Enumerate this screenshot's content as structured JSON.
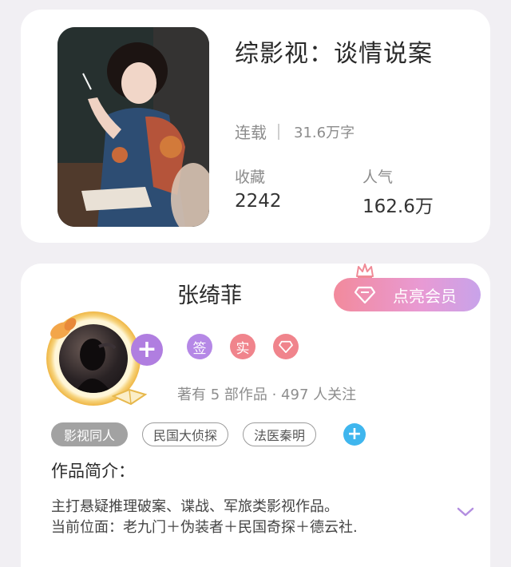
{
  "book": {
    "title": "综影视：谈情说案",
    "status": "连载",
    "word_count": "31.6万字",
    "favorites_label": "收藏",
    "favorites_value": "2242",
    "popularity_label": "人气",
    "popularity_value": "162.6万"
  },
  "author": {
    "name": "张绮菲",
    "vip_button": "点亮会员",
    "badges": [
      {
        "label": "签",
        "color": "#b588e6"
      },
      {
        "label": "实",
        "color": "#f0848c"
      },
      {
        "label": "diamond-icon",
        "color": "#f0848c"
      }
    ],
    "follow_text": "著有 5 部作品 · 497 人关注",
    "tags": [
      "影视同人",
      "民国大侦探",
      "法医秦明"
    ],
    "intro_title": "作品简介：",
    "intro_lines": [
      "主打悬疑推理破案、谍战、军旅类影视作品。",
      "当前位面：老九门＋伪装者＋民国奇探＋德云社."
    ]
  },
  "colors": {
    "accent_purple": "#b07ee0",
    "tag_plus_blue": "#3fb6ee"
  }
}
